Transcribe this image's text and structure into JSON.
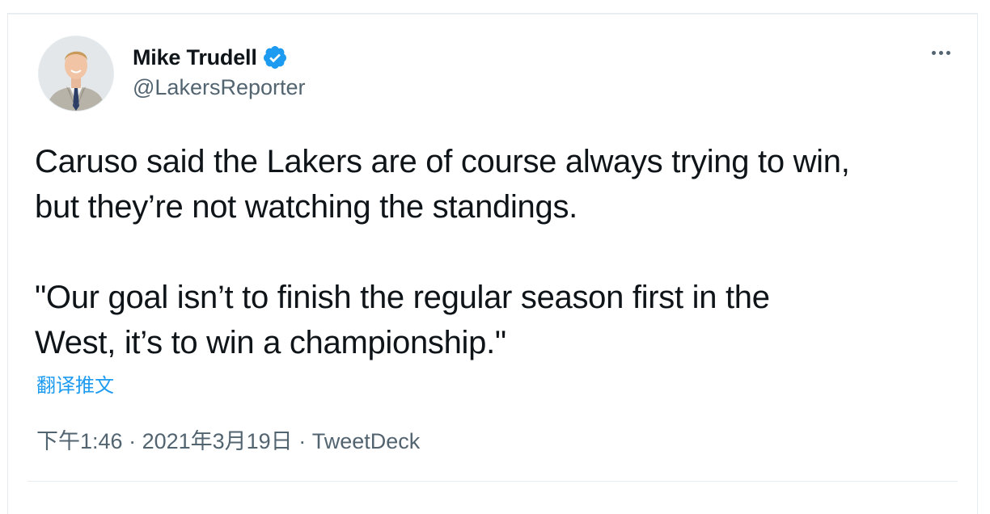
{
  "author": {
    "display_name": "Mike Trudell",
    "handle": "@LakersReporter",
    "verified": true
  },
  "tweet": {
    "lines_paragraph1": [
      "Caruso said the Lakers are of course always trying to win,",
      "but they’re not watching the standings."
    ],
    "lines_paragraph2": [
      "\"Our goal isn’t to finish the regular season first in the",
      "West, it’s to win a championship.\""
    ],
    "translate_label": "翻译推文"
  },
  "meta": {
    "time": "下午1:46",
    "sep1": " · ",
    "date": "2021年3月19日",
    "sep2": " · ",
    "source": "TweetDeck"
  },
  "icons": {
    "verified": "verified-badge-icon",
    "more": "more-options-icon"
  },
  "colors": {
    "link_blue": "#1d9bf0",
    "secondary_text": "#536471",
    "primary_text": "#0f1419"
  }
}
